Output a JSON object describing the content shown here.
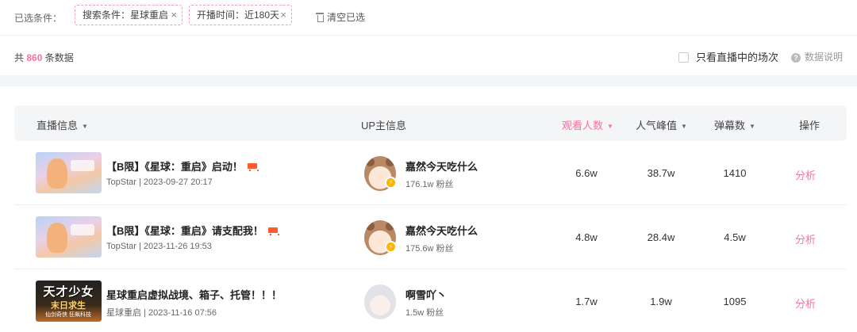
{
  "filters": {
    "label": "已选条件：",
    "chips": [
      {
        "text": "搜索条件：星球重启",
        "close": "×"
      },
      {
        "text": "开播时间：近180天",
        "close": "×"
      }
    ],
    "clear_label": "清空已选"
  },
  "summary": {
    "prefix": "共",
    "count": "860",
    "suffix": "条数据",
    "live_only_label": "只看直播中的场次",
    "data_note_label": "数据说明"
  },
  "table": {
    "headers": {
      "live_info": "直播信息",
      "up_info": "UP主信息",
      "views": "观看人数",
      "peak": "人气峰值",
      "danmu": "弹幕数",
      "action": "操作"
    },
    "sort_caret": "▼",
    "rows": [
      {
        "title": "【B限】《星球：重启》启动！",
        "meta": "TopStar | 2023-09-27 20:17",
        "up_name": "嘉然今天吃什么",
        "fans": "176.1w 粉丝",
        "views": "6.6w",
        "peak": "38.7w",
        "danmu": "1410",
        "action": "分析"
      },
      {
        "title": "【B限】《星球：重启》请支配我！",
        "meta": "TopStar | 2023-11-26 19:53",
        "up_name": "嘉然今天吃什么",
        "fans": "175.6w 粉丝",
        "views": "4.8w",
        "peak": "28.4w",
        "danmu": "4.5w",
        "action": "分析"
      },
      {
        "title": "星球重启虚拟战境、箱子、托管！！！",
        "meta": "星球重启 | 2023-11-16 07:56",
        "up_name": "啊雪吖丶",
        "fans": "1.5w 粉丝",
        "views": "1.7w",
        "peak": "1.9w",
        "danmu": "1095",
        "action": "分析",
        "thumb_text": {
          "title": "天才少女",
          "sub": "末日求生",
          "sub2": "仙剑奇侠  狂飙科技"
        }
      }
    ]
  },
  "colors": {
    "accent": "#fb7299",
    "chip_border": "#f3a0b0",
    "header_bg": "#f4f5f7",
    "badge": "#ffb400"
  },
  "icons": [
    "close-icon",
    "trash-icon",
    "checkbox-icon",
    "question-icon",
    "sort-caret-icon",
    "cart-icon",
    "lightning-badge-icon"
  ]
}
